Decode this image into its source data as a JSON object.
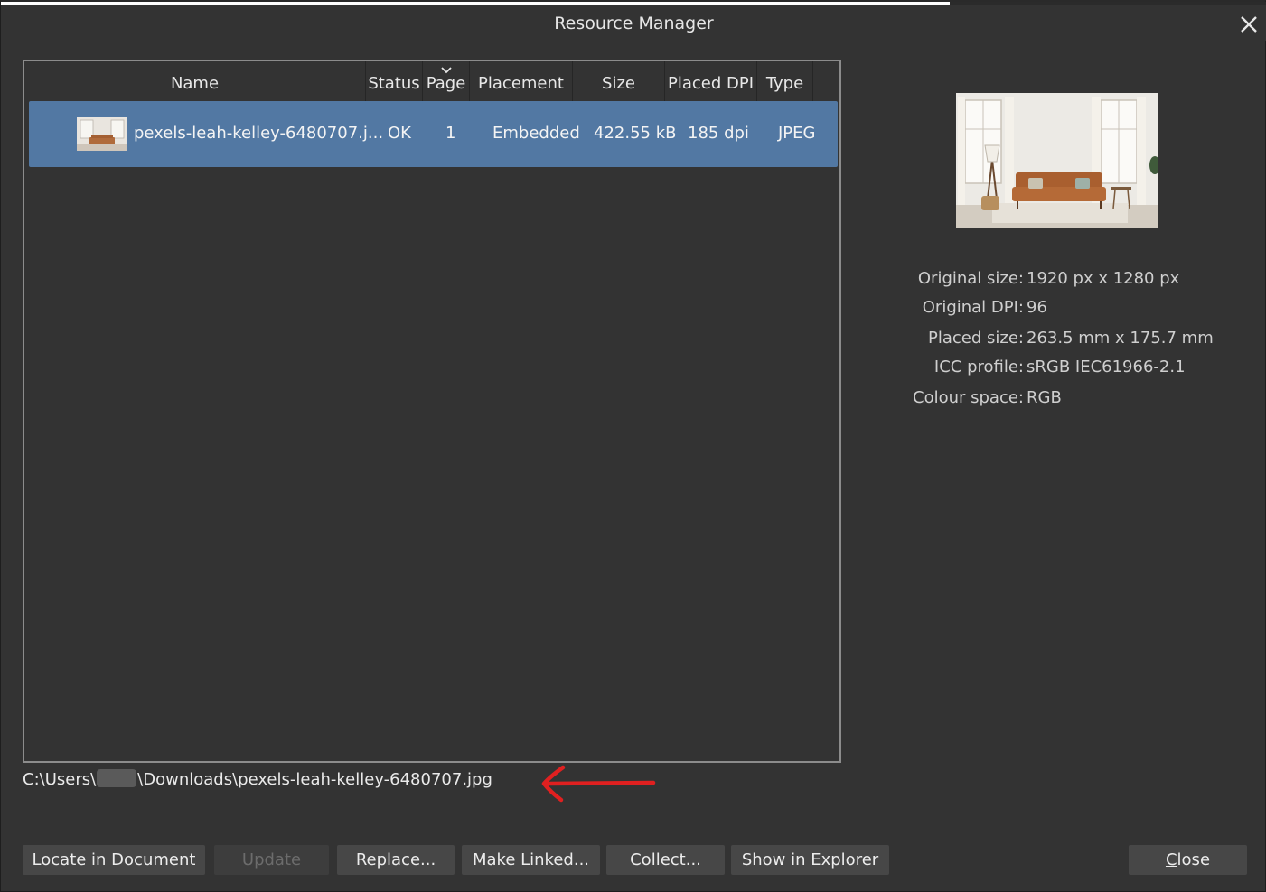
{
  "window": {
    "title": "Resource Manager"
  },
  "table": {
    "columns": [
      "Name",
      "Status",
      "Page",
      "Placement",
      "Size",
      "Placed DPI",
      "Type"
    ],
    "sorted_column": "Page",
    "rows": [
      {
        "name": "pexels-leah-kelley-6480707.j...",
        "status": "OK",
        "page": "1",
        "placement": "Embedded",
        "size": "422.55 kB",
        "placed_dpi": "185 dpi",
        "type": "JPEG",
        "selected": true
      }
    ]
  },
  "details": {
    "original_size_label": "Original size:",
    "original_size_value": "1920 px x 1280 px",
    "original_dpi_label": "Original DPI:",
    "original_dpi_value": "96",
    "placed_size_label": "Placed size:",
    "placed_size_value": "263.5 mm x 175.7 mm",
    "icc_profile_label": "ICC profile:",
    "icc_profile_value": "sRGB IEC61966-2.1",
    "colour_space_label": "Colour space:",
    "colour_space_value": "RGB"
  },
  "path": {
    "prefix": "C:\\Users\\",
    "suffix": "\\Downloads\\pexels-leah-kelley-6480707.jpg"
  },
  "buttons": {
    "locate": "Locate in Document",
    "update": "Update",
    "replace": "Replace...",
    "make_linked": "Make Linked...",
    "collect": "Collect...",
    "show_in_explorer": "Show in Explorer",
    "close_first": "C",
    "close_rest": "lose"
  },
  "colors": {
    "background": "#333333",
    "selection": "#5278a3",
    "annotation_arrow": "#e02020"
  },
  "icons": {
    "close": "close-icon",
    "sort": "chevron-down-icon",
    "annotation": "red-arrow-left"
  }
}
